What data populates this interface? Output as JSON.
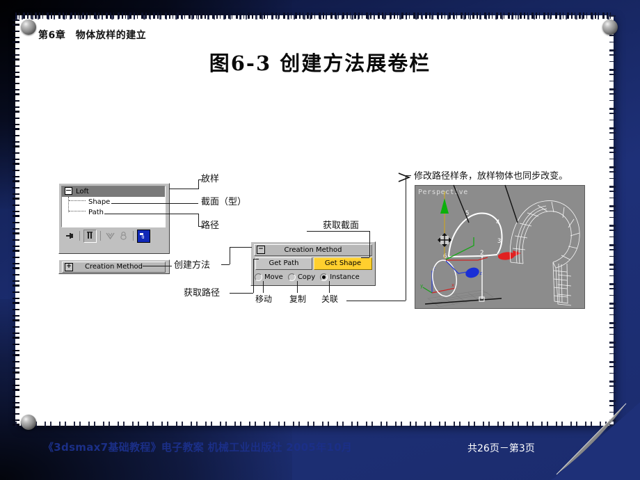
{
  "slide": {
    "chapter": "第6章　物体放样的建立",
    "title": "图6-3 创建方法展卷栏",
    "footer": "《3dsmax7基础教程》电子教案  机械工业出版社  2005年10月",
    "page_indicator": "共26页－第3页",
    "background_color": "#1e3078",
    "paper_color": "#ffffff",
    "footer_color": "#1b2f87"
  },
  "loft_panel": {
    "tree": {
      "root_label": "Loft",
      "root_toggle": "−",
      "children": [
        {
          "label": "Shape"
        },
        {
          "label": "Path"
        }
      ]
    },
    "toolbar": [
      {
        "name": "pin-stack-icon",
        "glyph": "⊣"
      },
      {
        "name": "sub-object-icon",
        "glyph": "▮"
      },
      {
        "name": "merge-down-icon",
        "glyph": "∨"
      },
      {
        "name": "lock-icon",
        "glyph": "⌂"
      },
      {
        "name": "configure-icon",
        "glyph": "▤"
      }
    ],
    "rollout_collapsed": {
      "sign": "+",
      "label": "Creation Method"
    }
  },
  "creation_method": {
    "header_sign": "−",
    "header_label": "Creation Method",
    "get_path_label": "Get Path",
    "get_shape_label": "Get Shape",
    "get_shape_highlight_color": "#ffcf2e",
    "radios": [
      {
        "label": "Move",
        "selected": false
      },
      {
        "label": "Copy",
        "selected": false
      },
      {
        "label": "Instance",
        "selected": true
      }
    ]
  },
  "viewport": {
    "label": "Perspective",
    "background_color": "#8c8c8c",
    "vertex_numbers": [
      "2",
      "3",
      "4",
      "5",
      "6"
    ],
    "axis_labels": {
      "x": "x",
      "y": "y",
      "z": "z"
    }
  },
  "annotations": {
    "loft": "放样",
    "shape": "截面（型）",
    "path": "路径",
    "creation_method": "创建方法",
    "get_path": "获取路径",
    "get_shape": "获取截面",
    "move": "移动",
    "copy": "复制",
    "instance": "关联",
    "note_prefix": "修改",
    "note_u1": "路径样条",
    "note_mid": "，",
    "note_u2": "放样物体",
    "note_suffix": "也同步改变。"
  }
}
